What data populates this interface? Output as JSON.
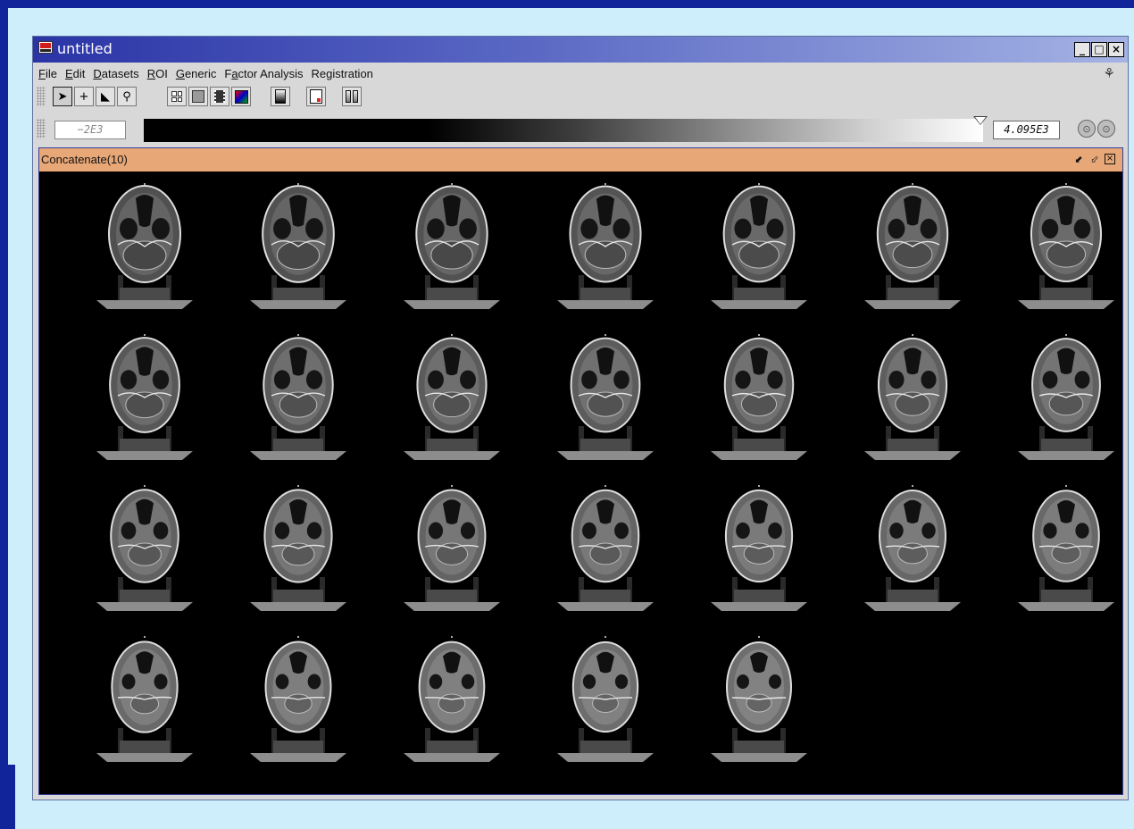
{
  "window": {
    "title": "untitled",
    "buttons": [
      "_",
      "□",
      "×"
    ]
  },
  "menubar": {
    "items": [
      {
        "label": "File",
        "u": "F"
      },
      {
        "label": "Edit",
        "u": "E"
      },
      {
        "label": "Datasets",
        "u": "D"
      },
      {
        "label": "ROI",
        "u": "R"
      },
      {
        "label": "Generic",
        "u": "G"
      },
      {
        "label": "Factor Analysis",
        "u": "a"
      },
      {
        "label": "Registration",
        "u": "g"
      }
    ]
  },
  "toolbar": {
    "tools": [
      "pointer",
      "crosshair",
      "region-select",
      "magnify"
    ],
    "views": [
      "tile-grid",
      "single-view",
      "film-strip",
      "color-map"
    ],
    "luts": [
      "lut-grey",
      "lut-red",
      "lut-dual"
    ]
  },
  "colorbar": {
    "min_value": "−2E3",
    "max_value": "4.095E3"
  },
  "inner_window": {
    "title": "Concatenate(10)"
  },
  "slices": {
    "count": 26,
    "columns": 7
  },
  "icons": {
    "app": "app-logo-icon",
    "tree": "tree-icon",
    "undock": "undock-icon",
    "close": "close-icon",
    "zoom_in": "zoom-in-icon",
    "zoom_out": "zoom-out-icon"
  }
}
